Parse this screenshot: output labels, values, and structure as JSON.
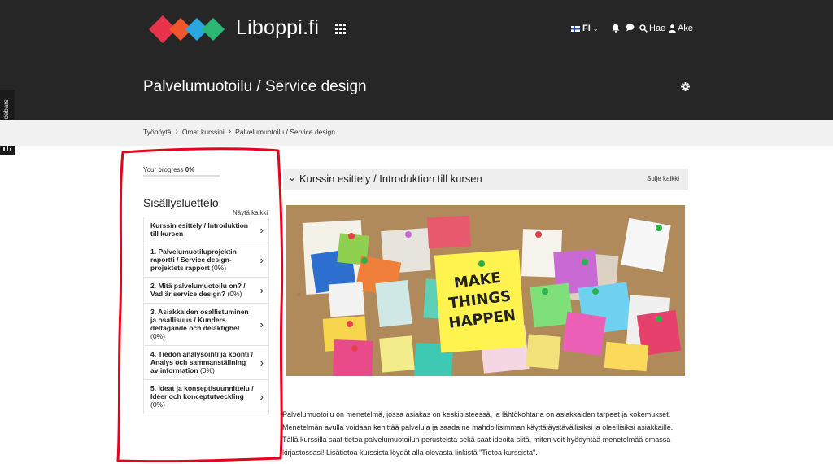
{
  "header": {
    "brand": "Liboppi.fi",
    "language": "FI",
    "search_label": "Hae",
    "user_name": "Ake",
    "course_title": "Palvelumuotoilu / Service design"
  },
  "hide_sidebars_label": "Hide sidebars",
  "breadcrumb": [
    "Työpöytä",
    "Omat kurssini",
    "Palvelumuotoilu / Service design"
  ],
  "sidebar": {
    "progress_label": "Your progress",
    "progress_value": "0%",
    "progress_fraction": 0,
    "toc_title": "Sisällysluettelo",
    "show_all": "Näytä kaikki",
    "items": [
      {
        "label": "Kurssin esittely / Introduktion till kursen",
        "pct": ""
      },
      {
        "label": "1. Palvelumuotiluprojektin raportti / Service design-projektets rapport",
        "pct": "(0%)"
      },
      {
        "label": "2. Mitä palvelumuotoilu on? / Vad är service design?",
        "pct": "(0%)"
      },
      {
        "label": "3. Asiakkaiden osallistuminen ja osallisuus / Kunders deltagande och delaktighet",
        "pct": "(0%)"
      },
      {
        "label": "4. Tiedon analysointi ja koonti / Analys och sammanställning av information",
        "pct": "(0%)"
      },
      {
        "label": "5. Ideat ja konseptisuunnittelu / Idéer och konceptutveckling",
        "pct": "(0%)"
      }
    ]
  },
  "main": {
    "section_title": "Kurssin esittely / Introduktion till kursen",
    "collapse_all": "Sulje kaikki",
    "board_note_text": [
      "MAKE",
      "THINGS",
      "HAPPEN"
    ],
    "intro_text": "Palvelumuotoilu on menetelmä, jossa asiakas on keskipisteessä, ja lähtökohtana on asiakkaiden tarpeet ja kokemukset. Menetelmän avulla voidaan kehittää palveluja ja saada ne mahdollisimman käyttäjäystävällisiksi ja oleellisiksi asiakkaille. Tällä kurssilla saat tietoa palvelumuotoilun perusteista sekä saat ideoita siitä, miten voit hyödyntää menetelmää omassa kirjastossasi! Lisätietoa kurssista löydät alla olevasta linkistä \"Tietoa kurssista\"."
  },
  "colors": {
    "topbar": "#262626",
    "accent_red": "#e8001c",
    "logo": [
      "#e8334a",
      "#f0552b",
      "#2aa7df",
      "#2bb673"
    ]
  }
}
